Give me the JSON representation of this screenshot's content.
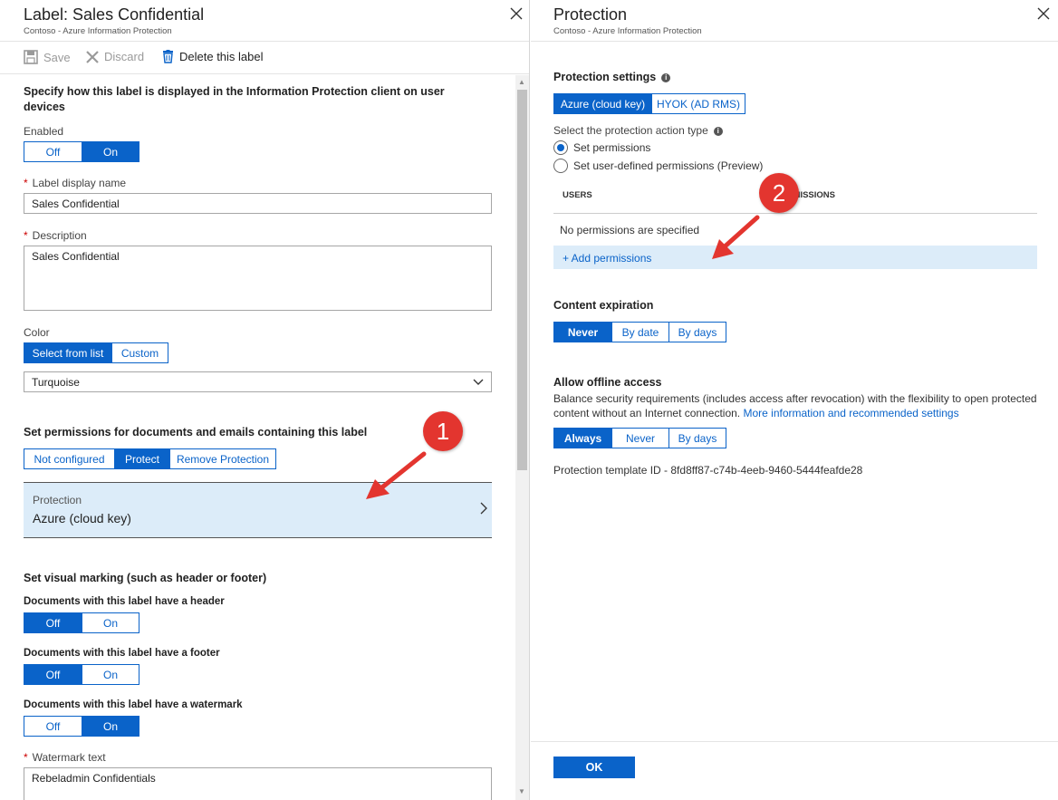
{
  "left_blade": {
    "title": "Label: Sales Confidential",
    "subtitle": "Contoso - Azure Information Protection",
    "toolbar": {
      "save": "Save",
      "discard": "Discard",
      "delete": "Delete this label"
    },
    "display_heading": "Specify how this label is displayed in the Information Protection client on user devices",
    "enabled_label": "Enabled",
    "enabled_options": [
      "Off",
      "On"
    ],
    "enabled_selected": "On",
    "display_name_label": "Label display name",
    "display_name_value": "Sales Confidential",
    "description_label": "Description",
    "description_value": "Sales Confidential",
    "color_label": "Color",
    "color_modes": [
      "Select from list",
      "Custom"
    ],
    "color_mode_selected": "Select from list",
    "color_value": "Turquoise",
    "permissions_heading": "Set permissions for documents and emails containing this label",
    "permission_options": [
      "Not configured",
      "Protect",
      "Remove Protection"
    ],
    "permission_selected": "Protect",
    "protection_card_label": "Protection",
    "protection_card_value": "Azure (cloud key)",
    "marking_heading": "Set visual marking (such as header or footer)",
    "header_label": "Documents with this label have a header",
    "header_options": [
      "Off",
      "On"
    ],
    "header_selected": "Off",
    "footer_label": "Documents with this label have a footer",
    "footer_options": [
      "Off",
      "On"
    ],
    "footer_selected": "Off",
    "watermark_label": "Documents with this label have a watermark",
    "watermark_options": [
      "Off",
      "On"
    ],
    "watermark_selected": "On",
    "watermark_text_label": "Watermark text",
    "watermark_text_value": "Rebeladmin Confidentials"
  },
  "right_blade": {
    "title": "Protection",
    "subtitle": "Contoso - Azure Information Protection",
    "settings_heading": "Protection settings",
    "key_options": [
      "Azure (cloud key)",
      "HYOK (AD RMS)"
    ],
    "key_selected": "Azure (cloud key)",
    "action_type_label": "Select the protection action type",
    "radio_set": "Set permissions",
    "radio_user_defined": "Set user-defined permissions (Preview)",
    "table_col_users": "USERS",
    "table_col_permissions": "PERMISSIONS",
    "no_permissions": "No permissions are specified",
    "add_permissions": "+ Add permissions",
    "expiration_heading": "Content expiration",
    "expiration_options": [
      "Never",
      "By date",
      "By days"
    ],
    "expiration_selected": "Never",
    "offline_heading": "Allow offline access",
    "offline_desc_1": "Balance security requirements (includes access after revocation) with the flexibility to open protected",
    "offline_desc_2": "content without an Internet connection.",
    "offline_link": "More information and recommended settings",
    "offline_options": [
      "Always",
      "Never",
      "By days"
    ],
    "offline_selected": "Always",
    "template_id": "Protection template ID - 8fd8ff87-c74b-4eeb-9460-5444feafde28",
    "ok_label": "OK"
  },
  "annotations": {
    "badge_1": "1",
    "badge_2": "2"
  },
  "colors": {
    "accent": "#0a63c9",
    "selected_bg": "#dcecf9",
    "badge": "#e3352f",
    "required": "#cc0000"
  },
  "icons": [
    "close-icon",
    "save-icon",
    "discard-icon",
    "delete-icon",
    "chevron-down-icon",
    "chevron-right-icon",
    "info-icon",
    "arrow-icon"
  ]
}
